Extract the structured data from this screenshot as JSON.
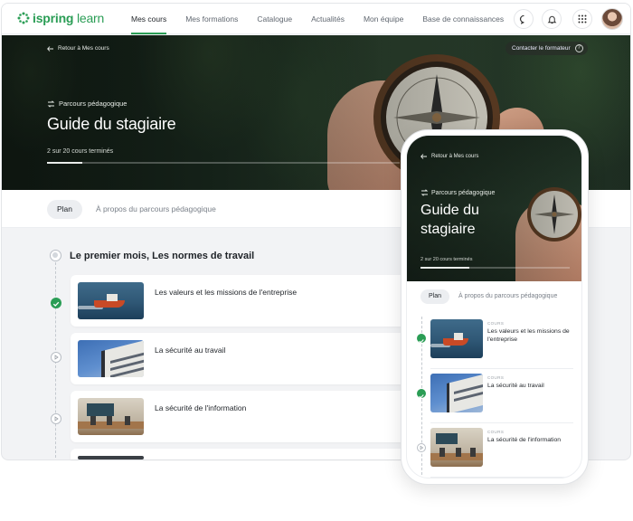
{
  "brand": {
    "name_bold": "ispring",
    "name_rest": " learn",
    "accent": "#2a9d55"
  },
  "nav": {
    "items": [
      {
        "label": "Mes cours",
        "active": true
      },
      {
        "label": "Mes formations"
      },
      {
        "label": "Catalogue"
      },
      {
        "label": "Actualités"
      },
      {
        "label": "Mon équipe"
      },
      {
        "label": "Base de connaissances"
      }
    ],
    "icons": [
      "chat-icon",
      "bell-icon",
      "apps-grid-icon"
    ]
  },
  "hero": {
    "back_label": "Retour à Mes cours",
    "contact_label": "Contacter le formateur",
    "contact_help": "?",
    "kicker": "Parcours pédagogique",
    "title": "Guide du stagiaire",
    "progress_text": "2 sur 20 cours terminés",
    "progress_fraction": 0.1
  },
  "tabs": {
    "active": "Plan",
    "other": "À propos du parcours pédagogique"
  },
  "section": {
    "title": "Le premier mois, Les normes de travail"
  },
  "courses": [
    {
      "title": "Les valeurs et les missions de l'entreprise",
      "status": "done",
      "thumb": "ship"
    },
    {
      "title": "La sécurité au travail",
      "status": "pending",
      "thumb": "building"
    },
    {
      "title": "La sécurité de l'information",
      "status": "pending",
      "thumb": "office"
    }
  ],
  "mobile": {
    "back_label": "Retour à Mes cours",
    "kicker": "Parcours pédagogique",
    "title": "Guide du stagiaire",
    "progress_text": "2 sur 20 cours terminés",
    "tab_active": "Plan",
    "tab_other": "À propos du parcours pédagogique",
    "course_label": "COURS",
    "courses": [
      {
        "title": "Les valeurs et les missions de l'entreprise",
        "status": "done"
      },
      {
        "title": "La sécurité au travail",
        "status": "done"
      },
      {
        "title": "La sécurité de l'information",
        "status": "pending"
      }
    ]
  }
}
